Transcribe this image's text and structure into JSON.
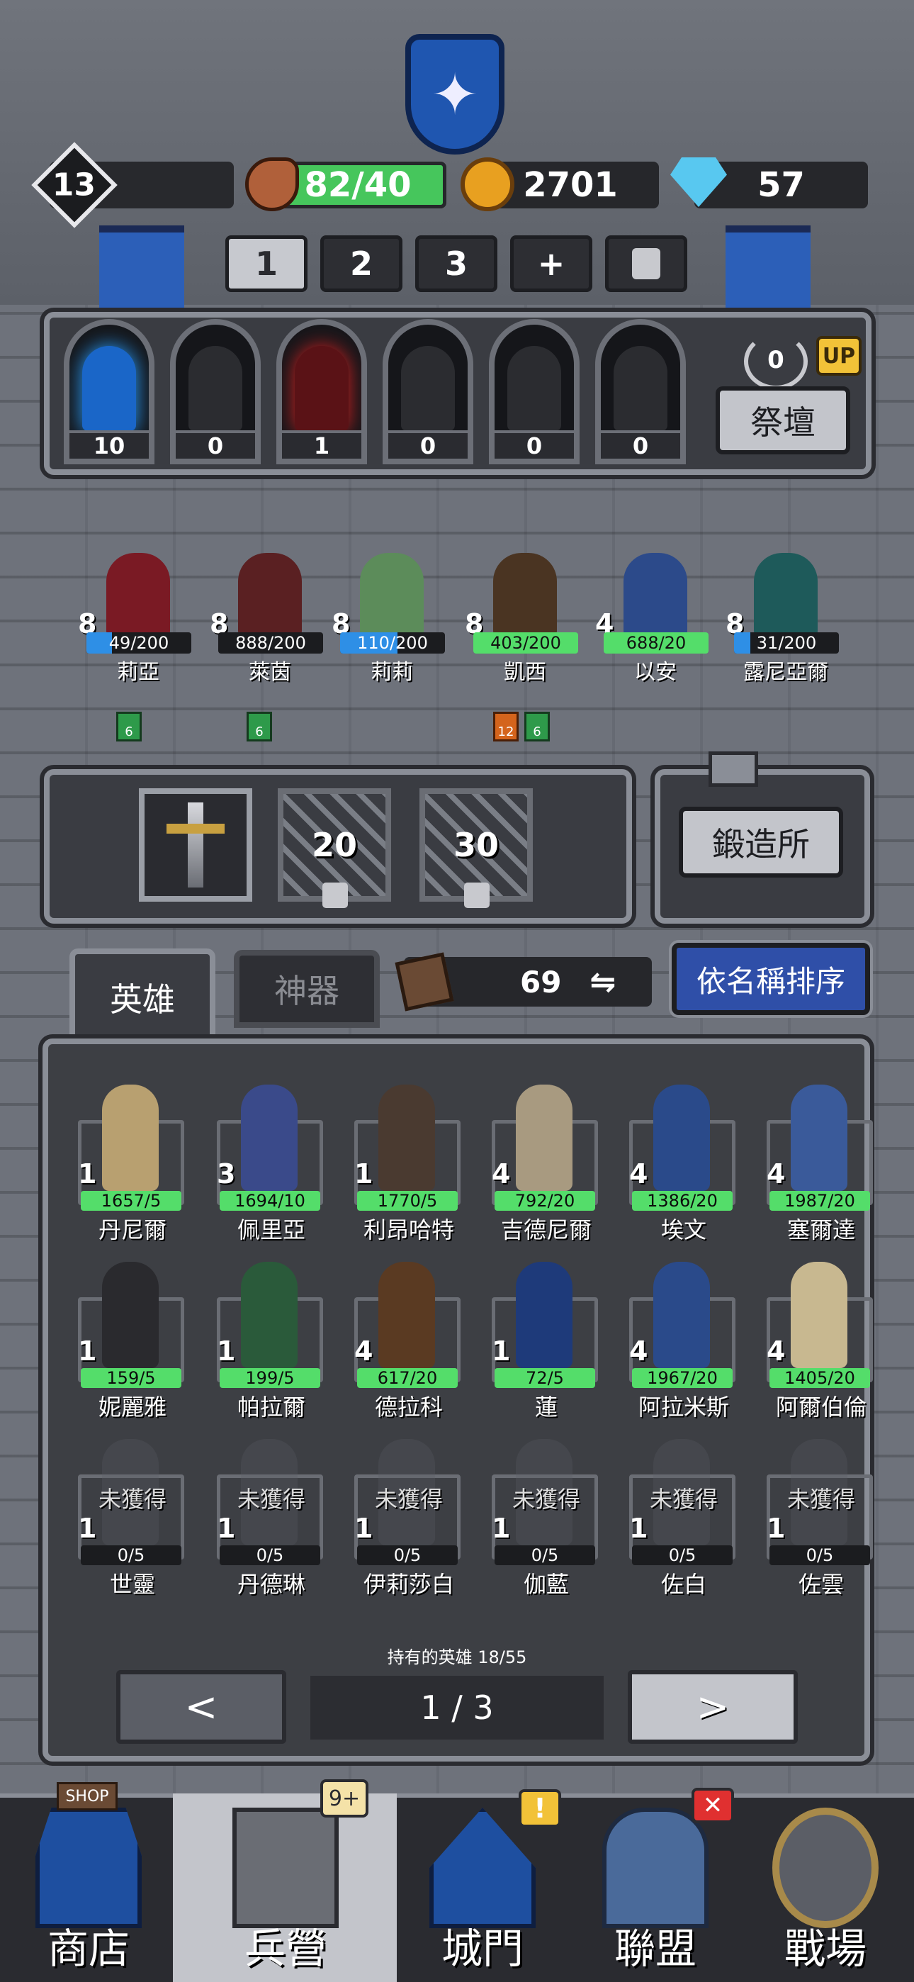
{
  "header": {
    "level": "13",
    "stamina": "82/40",
    "gold": "2701",
    "gems": "57"
  },
  "team_tabs": [
    "1",
    "2",
    "3",
    "+"
  ],
  "altar": {
    "gates": [
      "10",
      "0",
      "1",
      "0",
      "0",
      "0"
    ],
    "score": "0",
    "up_badge": "UP",
    "button": "祭壇"
  },
  "party": [
    {
      "level": "8",
      "exp": "49/200",
      "name": "莉亞",
      "progress": 0.245,
      "color": "#7a1a24"
    },
    {
      "level": "8",
      "exp": "888/200",
      "name": "萊茵",
      "progress": 1,
      "color": "#5a2022"
    },
    {
      "level": "8",
      "exp": "110/200",
      "name": "莉莉",
      "progress": 0.55,
      "color": "#5c8c5a"
    },
    {
      "level": "8",
      "exp": "403/200",
      "name": "凱西",
      "progress": 1,
      "color": "#4a3422"
    },
    {
      "level": "4",
      "exp": "688/20",
      "name": "以安",
      "progress": 1,
      "color": "#2c4a8a"
    },
    {
      "level": "8",
      "exp": "31/200",
      "name": "露尼亞爾",
      "progress": 0.155,
      "color": "#1e5a5a"
    }
  ],
  "party_badges": [
    {
      "value": "6",
      "type": "green"
    },
    {
      "value": "6",
      "type": "green"
    },
    {
      "value": "12",
      "type": "orange"
    },
    {
      "value": "6",
      "type": "green"
    }
  ],
  "equipment": {
    "slot2": "20",
    "slot3": "30",
    "forge_button": "鍛造所"
  },
  "tabs": {
    "heroes": "英雄",
    "artifacts": "神器",
    "book_count": "69",
    "sort_button": "依名稱排序"
  },
  "heroes": [
    {
      "level": "1",
      "exp": "1657/5",
      "name": "丹尼爾",
      "color": "#b8a070"
    },
    {
      "level": "3",
      "exp": "1694/10",
      "name": "佩里亞",
      "color": "#3a4a8a"
    },
    {
      "level": "1",
      "exp": "1770/5",
      "name": "利昂哈特",
      "color": "#4a3a30"
    },
    {
      "level": "4",
      "exp": "792/20",
      "name": "吉德尼爾",
      "color": "#a89a80"
    },
    {
      "level": "4",
      "exp": "1386/20",
      "name": "埃文",
      "color": "#2a4a8a"
    },
    {
      "level": "4",
      "exp": "1987/20",
      "name": "塞爾達",
      "color": "#3a5a9a"
    },
    {
      "level": "1",
      "exp": "159/5",
      "name": "妮麗雅",
      "color": "#2a2a2e"
    },
    {
      "level": "1",
      "exp": "199/5",
      "name": "帕拉爾",
      "color": "#2a5a3a"
    },
    {
      "level": "4",
      "exp": "617/20",
      "name": "德拉科",
      "color": "#5a3a22"
    },
    {
      "level": "1",
      "exp": "72/5",
      "name": "蓮",
      "color": "#1e3a7a"
    },
    {
      "level": "4",
      "exp": "1967/20",
      "name": "阿拉米斯",
      "color": "#2a4a8a"
    },
    {
      "level": "4",
      "exp": "1405/20",
      "name": "阿爾伯倫",
      "color": "#c8b890"
    }
  ],
  "locked_heroes": [
    {
      "status": "未獲得",
      "level": "1",
      "exp": "0/5",
      "name": "世靈"
    },
    {
      "status": "未獲得",
      "level": "1",
      "exp": "0/5",
      "name": "丹德琳"
    },
    {
      "status": "未獲得",
      "level": "1",
      "exp": "0/5",
      "name": "伊莉莎白"
    },
    {
      "status": "未獲得",
      "level": "1",
      "exp": "0/5",
      "name": "伽藍"
    },
    {
      "status": "未獲得",
      "level": "1",
      "exp": "0/5",
      "name": "佐白"
    },
    {
      "status": "未獲得",
      "level": "1",
      "exp": "0/5",
      "name": "佐雲"
    }
  ],
  "owned_text": "持有的英雄 18/55",
  "pagination": {
    "prev": "<",
    "page": "1 / 3",
    "next": ">"
  },
  "nav": {
    "shop": "商店",
    "shop_sign": "SHOP",
    "barracks": "兵營",
    "barracks_badge": "9+",
    "gate": "城門",
    "gate_badge": "!",
    "alliance": "聯盟",
    "alliance_badge": "✕",
    "arena": "戰場"
  },
  "colors": {
    "exp_fill": "#2e8fe6",
    "green_bar": "#54dd6a",
    "sort_blue": "#2f4fa8"
  }
}
